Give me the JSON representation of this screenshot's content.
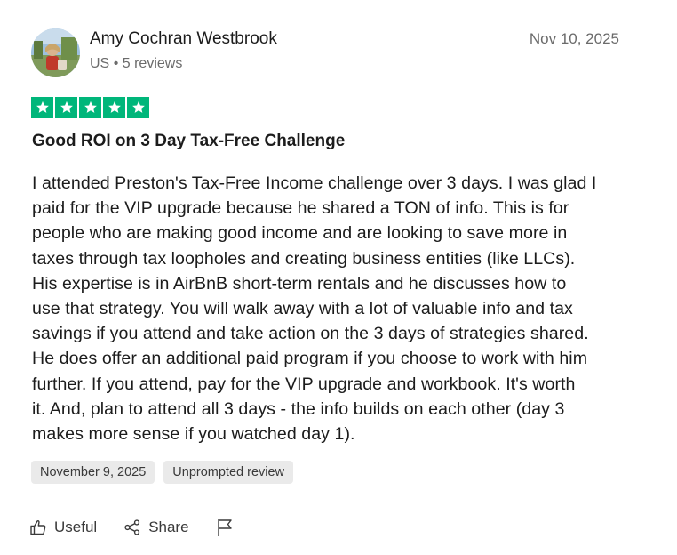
{
  "reviewer": {
    "name": "Amy Cochran Westbrook",
    "country": "US",
    "separator": "•",
    "reviews_count": "5 reviews"
  },
  "review": {
    "date": "Nov 10, 2025",
    "rating": 5,
    "rating_max": 5,
    "star_color": "#00b67a",
    "title": "Good ROI on 3 Day Tax-Free Challenge",
    "body_lines": [
      "I attended Preston's Tax-Free Income challenge over 3 days. I was glad I",
      "paid for the VIP upgrade because he shared a TON of info. This is for",
      "people who are making good income and are looking to save more in",
      "taxes through tax loopholes and creating business entities (like LLCs).",
      "His expertise is in AirBnB short-term rentals and he discusses how to",
      "use that strategy. You will walk away with a lot of valuable info and tax",
      "savings if you attend and take action on the 3 days of strategies shared.",
      "He does offer an additional paid program if you choose to work with him",
      "further. If you attend, pay for the VIP upgrade and workbook. It's worth",
      "it. And, plan to attend all 3 days - the info builds on each other (day 3",
      "makes more sense if you watched day 1)."
    ],
    "experience_date": "November 9, 2025",
    "review_type": "Unprompted review"
  },
  "actions": {
    "useful_label": "Useful",
    "share_label": "Share"
  },
  "icons": {
    "star": "star-icon",
    "useful": "thumbs-up-icon",
    "share": "share-icon",
    "report": "flag-icon"
  }
}
